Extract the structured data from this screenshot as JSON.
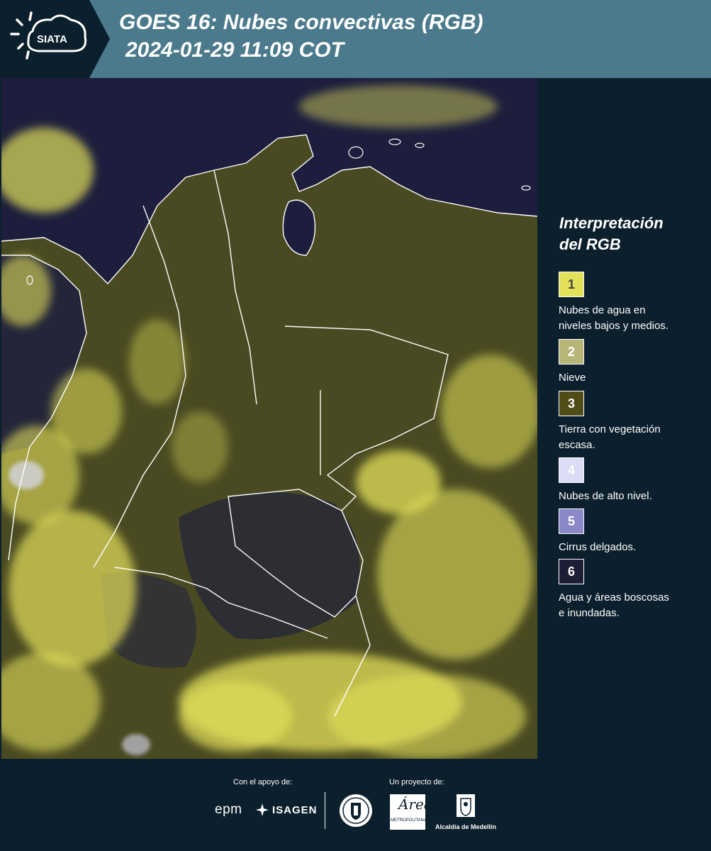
{
  "header": {
    "logo_text": "SIATA",
    "title_line1": "GOES 16: Nubes convectivas (RGB)",
    "title_line2": "2024-01-29 11:09 COT"
  },
  "legend": {
    "title_line1": "Interpretación",
    "title_line2": "del RGB",
    "items": [
      {
        "number": "1",
        "color": "#e3e05a",
        "text_color": "#444444",
        "label_line1": "Nubes de agua en",
        "label_line2": "niveles bajos y medios."
      },
      {
        "number": "2",
        "color": "#b7b577",
        "text_color": "#ffffff",
        "label_line1": "Nieve",
        "label_line2": ""
      },
      {
        "number": "3",
        "color": "#4f4c17",
        "text_color": "#ffffff",
        "label_line1": "Tierra con vegetación",
        "label_line2": "escasa."
      },
      {
        "number": "4",
        "color": "#dcdcf6",
        "text_color": "#ffffff",
        "label_line1": "Nubes de alto nivel.",
        "label_line2": ""
      },
      {
        "number": "5",
        "color": "#8b88c8",
        "text_color": "#ffffff",
        "label_line1": "Cirrus delgados.",
        "label_line2": ""
      },
      {
        "number": "6",
        "color": "#1e1d36",
        "text_color": "#ffffff",
        "label_line1": "Agua y áreas boscosas",
        "label_line2": "e inundadas."
      }
    ]
  },
  "footer": {
    "support_label": "Con el apoyo de:",
    "project_label": "Un proyecto de:",
    "epm": "epm",
    "isagen": "ISAGEN",
    "area_word": "Área",
    "area_sub": "METROPOLITANA",
    "alcaldia": "Alcaldía de Medellín"
  },
  "colors": {
    "header_bg": "#4a7a8c",
    "page_bg": "#0b1f2c",
    "ocean": "#1d1e3d",
    "land": "#4a4a22",
    "cloud": "#e2e05a"
  }
}
